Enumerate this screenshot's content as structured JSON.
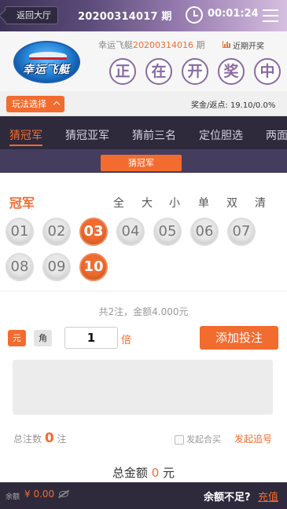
{
  "header": {
    "back_label": "返回大厅",
    "current_issue": "20200314017 期",
    "countdown": "00:01:24"
  },
  "info": {
    "game_name": "幸运飞艇",
    "last_issue": "20200314016",
    "last_issue_suffix": "期",
    "recent_label": "近期开奖",
    "logo_text": "幸运飞艇",
    "status_chars": [
      "正",
      "在",
      "开",
      "奖",
      "中"
    ]
  },
  "play": {
    "select_label": "玩法选择",
    "bonus_label": "奖金/返点:",
    "bonus_value": "19.10/0.0%"
  },
  "tabs": [
    "猜冠军",
    "猜冠亚军",
    "猜前三名",
    "定位胆选",
    "两面"
  ],
  "sub_tab": "猜冠军",
  "board": {
    "position_label": "冠军",
    "quick_buttons": [
      "全",
      "大",
      "小",
      "单",
      "双",
      "清"
    ],
    "balls": [
      "01",
      "02",
      "03",
      "04",
      "05",
      "06",
      "07",
      "08",
      "09",
      "10"
    ],
    "selected": [
      "03",
      "10"
    ]
  },
  "summary": "共2注，金额4.000元",
  "bet": {
    "unit_yuan": "元",
    "unit_jiao": "角",
    "multiplier": "1",
    "multiplier_unit": "倍",
    "add_label": "添加投注"
  },
  "totals": {
    "count_label": "总注数",
    "count_value": "0",
    "count_unit": "注",
    "coop_label": "发起合买",
    "chase_label": "发起追号",
    "amount_label": "总金额",
    "amount_value": "0",
    "amount_unit": "元"
  },
  "footer": {
    "balance_label": "余额",
    "balance_value": "¥ 0.00",
    "insufficient": "余额不足?",
    "recharge": "充值"
  },
  "colors": {
    "accent": "#f26b2f",
    "dark": "#2e2a3c",
    "purple": "#8a6aa0"
  }
}
